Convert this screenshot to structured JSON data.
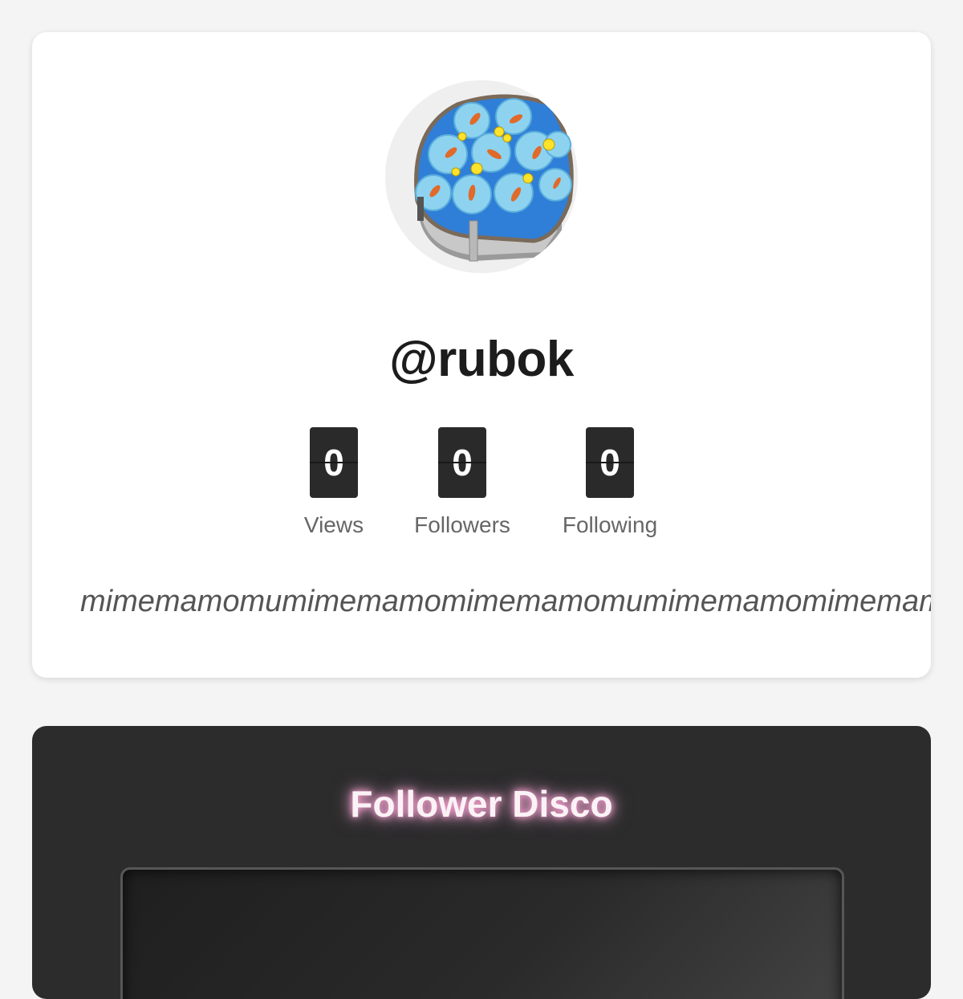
{
  "profile": {
    "username": "@rubok",
    "bio": "mimemamomumimemamomimemamomumimemamomimemamomumimemamomi",
    "stats": [
      {
        "value": "0",
        "label": "Views"
      },
      {
        "value": "0",
        "label": "Followers"
      },
      {
        "value": "0",
        "label": "Following"
      }
    ],
    "avatar_icon": "puzzle-photo-icon"
  },
  "disco": {
    "title": "Follower Disco",
    "glow_color": "#ff9fd2"
  },
  "colors": {
    "page_background": "#f4f4f4",
    "card_background": "#ffffff",
    "stat_box": "#2a2a2a",
    "disco_background": "#2c2c2c"
  }
}
